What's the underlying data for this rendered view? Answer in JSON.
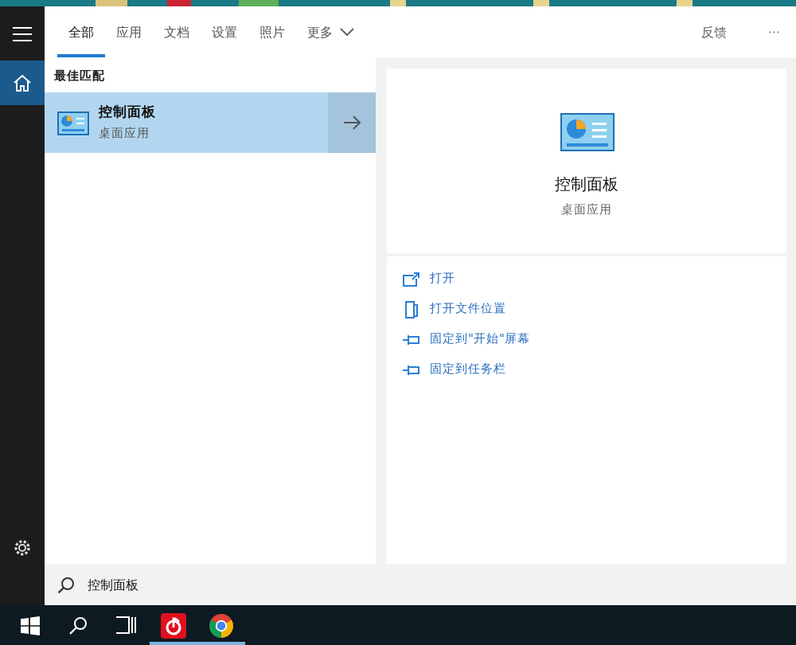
{
  "tabs": [
    {
      "label": "全部",
      "selected": true
    },
    {
      "label": "应用",
      "selected": false
    },
    {
      "label": "文档",
      "selected": false
    },
    {
      "label": "设置",
      "selected": false
    },
    {
      "label": "照片",
      "selected": false
    },
    {
      "label": "更多",
      "selected": false,
      "dropdown": true
    }
  ],
  "feedback": "反馈",
  "more_menu": "···",
  "rail": [
    {
      "kind": "home",
      "selected": true
    },
    {
      "kind": "settings",
      "selected": false
    }
  ],
  "best_match": {
    "heading": "最佳匹配",
    "title": "控制面板",
    "subtitle": "桌面应用",
    "selected": true
  },
  "detail": {
    "title": "控制面板",
    "subtitle": "桌面应用",
    "actions": [
      {
        "kind": "open",
        "label": "打开"
      },
      {
        "kind": "folder",
        "label": "打开文件位置"
      },
      {
        "kind": "pin",
        "label": "固定到\"开始\"屏幕"
      },
      {
        "kind": "pin",
        "label": "固定到任务栏"
      }
    ]
  },
  "search": {
    "value": "控制面板"
  },
  "taskbar": [
    {
      "kind": "start",
      "running": false
    },
    {
      "kind": "search",
      "running": false
    },
    {
      "kind": "taskview",
      "running": false
    },
    {
      "kind": "music",
      "running": true
    },
    {
      "kind": "chrome",
      "running": true
    }
  ]
}
